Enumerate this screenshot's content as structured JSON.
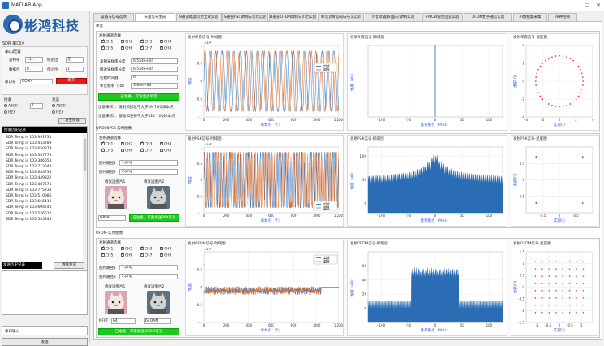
{
  "window": {
    "title": "MATLAB App",
    "minimize": "—",
    "maximize": "☐",
    "close": "✕"
  },
  "brand": {
    "name": "彬鸿科技",
    "tagline": "BINHONG SCIENCE & TECHNOLOGY"
  },
  "left": {
    "sdr_header": "SDR 串口区",
    "serial_config": "串口配置",
    "baud_label": "波特率",
    "baud_value": "11...",
    "check_label": "校验位",
    "check_value": "无",
    "data_label": "数据位",
    "data_value": "8",
    "stop_label": "停止位",
    "stop_value": "1",
    "port_label": "串口号",
    "port_value": "COM4",
    "open_button": "断开",
    "recv_label": "接收",
    "send_label": "发送",
    "recv_ascii": "ASCII",
    "recv_hex": "HEX",
    "recv_count": "1",
    "send_ascii": "ASCII",
    "send_hex": "HEX",
    "clear_recv": "清空接收",
    "recv_log_title": "接收历史记录",
    "recv_log": [
      "SDR Temp is 103.991731",
      "SDR Temp is 103.433289",
      "SDR Temp is 103.650879",
      "SDR Temp is 103.347778",
      "SDR Temp is 103.386658",
      "SDR Temp is 103.713043",
      "SDR Temp is 103.644738",
      "SDR Temp is 103.449922",
      "SDR Temp is 103.487671",
      "SDR Temp is 103.775238",
      "SDR Temp is 103.510986",
      "SDR Temp is 103.666412",
      "SDR Temp is 103.604248",
      "SDR Temp is 103.526520",
      "SDR Temp is 103.535345"
    ],
    "send_log_title": "发送历史记录",
    "clear_send": "清除发送",
    "serial_input_label": "串口输入",
    "send_button": "发送"
  },
  "tabs": [
    "设备与信号选项",
    "矢量信号生成",
    "8通道幅度可达全效实验",
    "8通道FSK调制与可达实验",
    "8通道OFDM调制与可达实验",
    "单音调制信号与方法实验",
    "单音调遥测-面向-调制实验",
    "FMCW雷达回波实验",
    "OFDM数字通信实验",
    "AI数据集采集",
    "AI神经网"
  ],
  "active_tab": 1,
  "sections": {
    "single": {
      "title": "单音",
      "channel_title": "发射通道选择",
      "channels": [
        "CH1",
        "CH2",
        "CH3",
        "CH4",
        "CH5",
        "CH6",
        "CH7",
        "CH8"
      ],
      "fields": [
        {
          "label": "发射采样率长度",
          "value": "6.554e+04"
        },
        {
          "label": "接收采样率长度",
          "value": "6.554e+04"
        },
        {
          "label": "初始时间戳",
          "value": "0"
        },
        {
          "label": "单音频率（Hz）",
          "value": "3.84e+06"
        }
      ],
      "status": "已准备，可发出点单音",
      "note1": "注意事项1：发射和接收不大于2M个I/Q样本点",
      "note2": "注意事项2：接收和发射不大于512个I/Q样本点",
      "plot_time": "发射单音信号-时域图",
      "plot_freq": "发射单音信号-频域图",
      "plot_const": "发射单音信号-星座图"
    },
    "qpsk": {
      "title": "QPSK/8PSK-实时图像",
      "channel_title": "发射通道选择",
      "channels": [
        "CH1",
        "CH2",
        "CH3",
        "CH4",
        "CH5",
        "CH6",
        "CH7",
        "CH8"
      ],
      "img1_label": "图片路径1",
      "img1_value": "1.png",
      "img2_label": "图片路径2",
      "img2_value": "2.png",
      "img_send1": "待发送图片1",
      "img_send2": "待发送图片2",
      "mod_value": "QPSK",
      "status": "已准备，可重发送PSK信号",
      "plot_time": "发射PSK信号-时域图",
      "plot_freq": "发射PSK信号-频域图",
      "plot_const": "发射PSK信号-星座图"
    },
    "ofdm": {
      "title": "OFDM-实时图像",
      "channel_title": "发射通道选择",
      "channels": [
        "CH1",
        "CH2",
        "CH3",
        "CH4",
        "CH5",
        "CH6",
        "CH7",
        "CH8"
      ],
      "img1_label": "图片路径1",
      "img1_value": "1.png",
      "img2_label": "图片路径2",
      "img2_value": "2.png",
      "img_send1": "待发送图片1",
      "img_send2": "待发送图片2",
      "nfft_label": "NFFT",
      "nfft_value": "64",
      "qam_value": "64QAM",
      "status": "已准备，可重发送OFDM信号",
      "plot_time": "发射OFDM信号-时域图",
      "plot_freq": "发射OFDM信号-频域图",
      "plot_const": "发射OFDM信号-星座图"
    }
  },
  "axes": {
    "time_x": "样本点（个）",
    "time_y": "幅度",
    "freq_x": "基带频点（MHz）",
    "freq_y": "幅度（dB）",
    "const_x": "实部(I)",
    "const_y": "虚部(Q)",
    "legend_real": "实部",
    "legend_imag": "虚部",
    "exp4": "×10⁴",
    "exp3": "×10⁻³",
    "exp4b": "×10⁴"
  },
  "colors": {
    "accent": "#1f5fa6",
    "real": "#2a6db5",
    "imag": "#e0651e",
    "red": "#e8181b",
    "green": "#1ec81e"
  }
}
